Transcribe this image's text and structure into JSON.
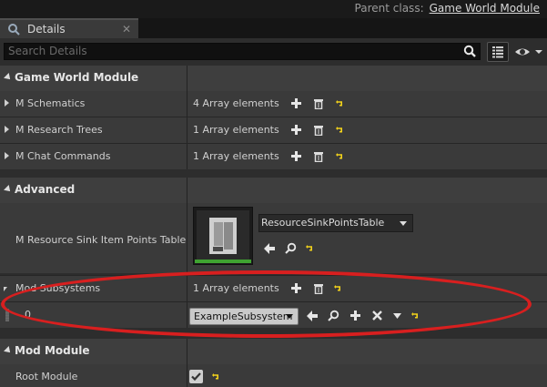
{
  "header": {
    "parent_class_label": "Parent class:",
    "parent_class_value": "Game World Module"
  },
  "tab": {
    "label": "Details",
    "close": "✕"
  },
  "search": {
    "placeholder": "Search Details"
  },
  "categories": {
    "game_world_module": "Game World Module",
    "advanced": "Advanced",
    "mod_module": "Mod Module"
  },
  "properties": {
    "schematics": {
      "label": "M Schematics",
      "value": "4 Array elements"
    },
    "research_trees": {
      "label": "M Research Trees",
      "value": "1 Array elements"
    },
    "chat_commands": {
      "label": "M Chat Commands",
      "value": "1 Array elements"
    },
    "resource_sink": {
      "label": "M Resource Sink Item Points Table",
      "value": "ResourceSinkPointsTable"
    },
    "mod_subsystems": {
      "label": "Mod Subsystems",
      "value": "1 Array elements"
    },
    "mod_subsystem_item": {
      "index": "0",
      "value": "ExampleSubsystem"
    },
    "root_module": {
      "label": "Root Module",
      "checked": true
    }
  },
  "colors": {
    "panel_bg": "#2d2d2d",
    "category_bg": "#3e3e3e",
    "highlight": "#d81f1f",
    "reset_arrow": "#f2d21b",
    "thumbnail_bar": "#3fa331"
  }
}
